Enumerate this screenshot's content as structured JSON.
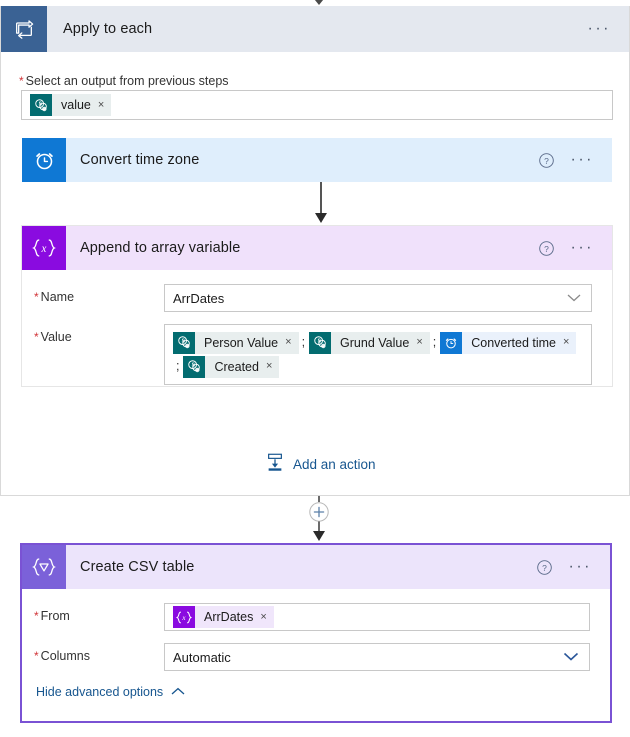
{
  "scope": {
    "title": "Apply to each",
    "icon": "loop-icon",
    "ellipsis": "···",
    "output_label": "Select an output from previous steps",
    "output_token": {
      "label": "value",
      "icon": "sharepoint-icon",
      "remove": "×"
    }
  },
  "convert_action": {
    "title": "Convert time zone",
    "icon": "alarm-clock-icon",
    "help": "?",
    "ellipsis": "···"
  },
  "append_action": {
    "title": "Append to array variable",
    "icon": "variable-braces-icon",
    "help": "?",
    "ellipsis": "···",
    "name_label": "Name",
    "name_value": "ArrDates",
    "value_label": "Value",
    "value_tokens": [
      {
        "label": "Person Value",
        "icon": "sharepoint-icon",
        "kind": "sp",
        "remove": "×",
        "sep": ";"
      },
      {
        "label": "Grund Value",
        "icon": "sharepoint-icon",
        "kind": "sp",
        "remove": "×",
        "sep": ";"
      },
      {
        "label": "Converted time",
        "icon": "alarm-clock-icon",
        "kind": "clock",
        "remove": "×",
        "sep": ";"
      },
      {
        "label": "Created",
        "icon": "sharepoint-icon",
        "kind": "sp",
        "remove": "×",
        "sep": ""
      }
    ]
  },
  "add_action": {
    "label": "Add an action",
    "icon": "insert-below-icon"
  },
  "connector": {
    "plus": "+"
  },
  "csv_action": {
    "title": "Create CSV table",
    "icon": "data-operation-braces-icon",
    "help": "?",
    "ellipsis": "···",
    "from_label": "From",
    "from_token": {
      "label": "ArrDates",
      "icon": "variable-braces-icon",
      "remove": "×"
    },
    "columns_label": "Columns",
    "columns_value": "Automatic",
    "advanced_label": "Hide advanced options"
  },
  "required_marker": "*",
  "colors": {
    "scope_icon": "#3a6294",
    "scope_header": "#e4e8ef",
    "convert_icon": "#0f78d4",
    "convert_header": "#dfeefc",
    "variable_icon": "#8a0be0",
    "variable_header": "#f0e1fb",
    "csv_icon": "#7b61d9",
    "csv_header": "#ece4fb",
    "csv_border": "#7a52d4",
    "sharepoint": "#036c70",
    "link": "#17568f",
    "required": "#d13438"
  }
}
